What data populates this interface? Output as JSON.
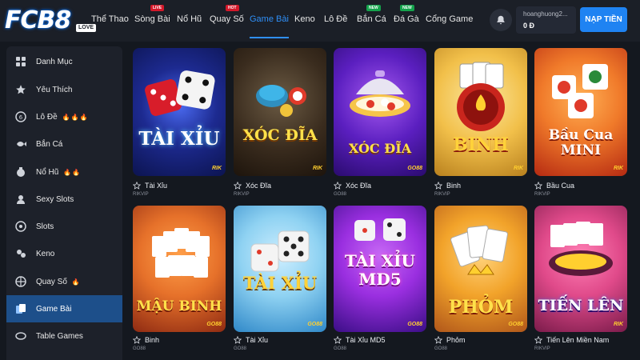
{
  "header": {
    "logo_text": "FCB8",
    "logo_tag": "LOVE",
    "nav": [
      {
        "label": "Thể Thao",
        "badge": ""
      },
      {
        "label": "Sòng Bài",
        "badge": "LIVE"
      },
      {
        "label": "Nổ Hũ",
        "badge": ""
      },
      {
        "label": "Quay Số",
        "badge": "HOT"
      },
      {
        "label": "Game Bài",
        "badge": ""
      },
      {
        "label": "Keno",
        "badge": ""
      },
      {
        "label": "Lô Đề",
        "badge": ""
      },
      {
        "label": "Bắn Cá",
        "badge": "NEW"
      },
      {
        "label": "Đá Gà",
        "badge": "NEW"
      },
      {
        "label": "Cổng Game",
        "badge": ""
      }
    ],
    "active_nav": "Game Bài",
    "username": "hoanghuong2...",
    "balance": "0 Đ",
    "deposit_label": "NẠP TIỀN"
  },
  "sidebar": {
    "items": [
      {
        "label": "Danh Mục",
        "icon": "grid-icon",
        "fires": ""
      },
      {
        "label": "Yêu Thích",
        "icon": "star-icon",
        "fires": ""
      },
      {
        "label": "Lô Đề",
        "icon": "lottery-ball-icon",
        "fires": "🔥🔥🔥"
      },
      {
        "label": "Bắn Cá",
        "icon": "fish-icon",
        "fires": ""
      },
      {
        "label": "Nổ Hũ",
        "icon": "jackpot-icon",
        "fires": "🔥🔥"
      },
      {
        "label": "Sexy Slots",
        "icon": "dealer-icon",
        "fires": ""
      },
      {
        "label": "Slots",
        "icon": "slot-machine-icon",
        "fires": ""
      },
      {
        "label": "Keno",
        "icon": "keno-icon",
        "fires": ""
      },
      {
        "label": "Quay Số",
        "icon": "wheel-icon",
        "fires": "🔥"
      },
      {
        "label": "Game Bài",
        "icon": "cards-icon",
        "fires": ""
      },
      {
        "label": "Table Games",
        "icon": "table-icon",
        "fires": ""
      }
    ],
    "active_item": "Game Bài"
  },
  "games": [
    {
      "name": "Tài Xỉu",
      "provider": "RIKVIP",
      "art_title": "TÀI XỈU",
      "colors": [
        "#2a3ea8",
        "#0c1450"
      ]
    },
    {
      "name": "Xóc Đĩa",
      "provider": "RIKVIP",
      "art_title": "XÓC ĐĨA",
      "colors": [
        "#5a4530",
        "#1d140c"
      ]
    },
    {
      "name": "Xóc Đĩa",
      "provider": "GO88",
      "art_title": "XÓC ĐĨA",
      "colors": [
        "#7a2fd6",
        "#2a0b6e"
      ]
    },
    {
      "name": "Binh",
      "provider": "RIKVIP",
      "art_title": "BINH",
      "colors": [
        "#f2d16a",
        "#b8801e"
      ]
    },
    {
      "name": "Bầu Cua",
      "provider": "RIKVIP",
      "art_title": "Bầu Cua MINI",
      "colors": [
        "#f07a2a",
        "#b52a12"
      ]
    },
    {
      "name": "Binh",
      "provider": "GO88",
      "art_title": "MẬU BINH",
      "colors": [
        "#e6712a",
        "#8e2a12"
      ]
    },
    {
      "name": "Tài Xỉu",
      "provider": "GO88",
      "art_title": "TÀI XỈU",
      "colors": [
        "#8fd2f2",
        "#2f88c8"
      ]
    },
    {
      "name": "Tài Xỉu MD5",
      "provider": "GO88",
      "art_title": "TÀI XỈU MD5",
      "colors": [
        "#9a2fe0",
        "#3a0e86"
      ]
    },
    {
      "name": "Phỏm",
      "provider": "GO88",
      "art_title": "PHỎM",
      "colors": [
        "#f2a32a",
        "#b0561a"
      ]
    },
    {
      "name": "Tiến Lên Miền Nam",
      "provider": "RIKVIP",
      "art_title": "TIẾN LÊN",
      "colors": [
        "#e04a8a",
        "#7a1b4a"
      ]
    }
  ],
  "accent_color": "#2f8ff7"
}
